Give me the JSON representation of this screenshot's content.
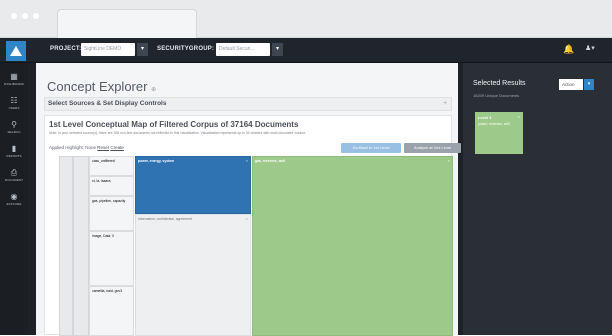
{
  "colors": {
    "accent_blue": "#2f73b3",
    "accent_green": "#9dc98a",
    "nav_bg": "#1b1f24",
    "topbar_bg": "#20252b",
    "panel_bg": "#2a2f35"
  },
  "topbar": {
    "project_label": "PROJECT:",
    "project_value": "SightLine DEMO",
    "securitygroup_label": "SECURITYGROUP:",
    "securitygroup_value": "Default Securi...",
    "caret": "▾",
    "notification_icon": "bell-icon",
    "notification_glyph": "🔔",
    "user_icon": "user-icon",
    "user_glyph": "♟▾"
  },
  "sidebar": {
    "items": [
      {
        "label": "DASHBOARD",
        "icon": "dashboard-icon",
        "glyph": "▦"
      },
      {
        "label": "USERS",
        "icon": "users-icon",
        "glyph": "☷"
      },
      {
        "label": "SEARCH",
        "icon": "search-icon",
        "glyph": "⚲"
      },
      {
        "label": "REPORTS",
        "icon": "reports-icon",
        "glyph": "▮"
      },
      {
        "label": "DOCUMENT",
        "icon": "document-icon",
        "glyph": "⎙"
      },
      {
        "label": "EXPLORE",
        "icon": "explore-icon",
        "glyph": "◉"
      }
    ]
  },
  "main": {
    "title": "Concept Explorer",
    "title_info_glyph": "⊕",
    "section_label": "Select Sources & Set Display Controls",
    "section_toggle": "+",
    "card_title": "1st Level Conceptual Map of Filtered Corpus of 37164 Documents",
    "card_note": "Note: In your selected source(s), there are 308 non-text documents not reflected in this visualization. Visualization represents up to 30 clusters with most document volume.",
    "highlight_label": "Applied Highlight: None",
    "highlight_reset": "Reset",
    "highlight_create": "Create",
    "back_button": "Go Back to 1st Level",
    "analyze_button": "Analyze at 2nd Level",
    "close_glyph": "×"
  },
  "treemap": {
    "cells": [
      {
        "label": "power, energy, system",
        "kind": "blue"
      },
      {
        "label": "gas, reserves, well",
        "kind": "green"
      },
      {
        "label": "information, confidential, agreement",
        "kind": "light"
      },
      {
        "label": "cass_unfiltered",
        "kind": "small"
      },
      {
        "label": "ct, la, isaacs",
        "kind": "small"
      },
      {
        "label": "gas, pipeline, capacity",
        "kind": "small"
      },
      {
        "label": "image, Data, 0",
        "kind": "small"
      },
      {
        "label": "camellia, naid, gov3",
        "kind": "small"
      }
    ]
  },
  "right_panel": {
    "title": "Selected Results",
    "subtitle": "18209 Unique Documents",
    "action_label": "Action",
    "action_caret": "▾",
    "card_level": "Level 1",
    "card_terms": "power, reserves, well",
    "card_close": "×"
  }
}
